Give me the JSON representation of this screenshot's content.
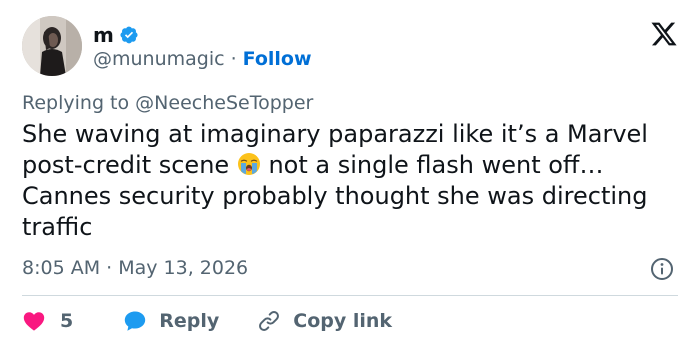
{
  "author": {
    "display_name": "m",
    "handle": "@munumagic",
    "separator": "·",
    "follow_label": "Follow"
  },
  "reply_to": {
    "prefix": "Replying to",
    "handle": "@NeecheSeTopper"
  },
  "tweet": {
    "text_before_emoji": "She waving at imaginary paparazzi like it’s a Marvel post-credit scene",
    "emoji": "loudly-crying-face",
    "text_after_emoji": "not a single flash went off… Cannes security probably thought she was directing traffic",
    "timestamp": "8:05 AM · May 13, 2026"
  },
  "actions": {
    "like_count": "5",
    "reply_label": "Reply",
    "copy_link_label": "Copy link"
  },
  "icons": {
    "verified": "verified-badge-icon",
    "logo": "x-logo-icon",
    "info": "info-icon",
    "like": "heart-icon",
    "reply": "speech-bubble-icon",
    "copy": "link-icon"
  },
  "colors": {
    "text_primary": "#0f1419",
    "text_secondary": "#536471",
    "link_blue": "#006fd6",
    "verified_blue": "#1d9bf0",
    "like_pink": "#f91880",
    "divider": "#cfd9de"
  }
}
